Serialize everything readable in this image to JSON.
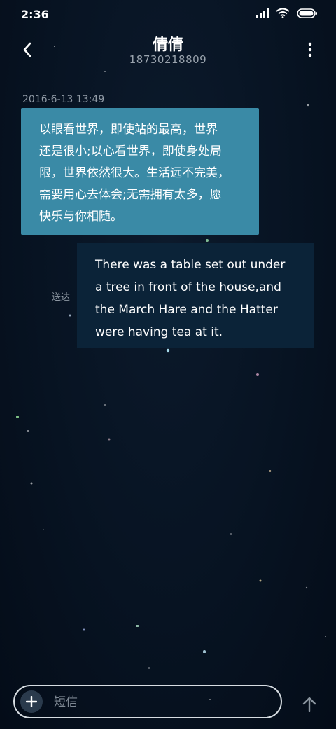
{
  "status_bar": {
    "time": "2:36",
    "icons": [
      "signal-icon",
      "wifi-icon",
      "battery-icon"
    ]
  },
  "header": {
    "contact_name": "倩倩",
    "contact_number": "18730218809",
    "back_icon": "chevron-left-icon",
    "menu_icon": "more-vertical-icon"
  },
  "conversation": {
    "timestamp": "2016-6-13 13:49",
    "messages": [
      {
        "direction": "incoming",
        "lines": [
          "以眼看世界，即使站的最高，世界",
          "还是很小;以心看世界，即使身处局",
          "限，世界依然很大。生活远不完美，",
          "需要用心去体会;无需拥有太多，愿",
          "快乐与你相随。"
        ]
      },
      {
        "direction": "outgoing",
        "lines": [
          "There was a table set out under",
          "a tree in front of the house,and",
          "the March Hare and the Hatter",
          "were having tea at it."
        ],
        "status": "送达"
      }
    ]
  },
  "composer": {
    "placeholder": "短信",
    "add_icon": "plus-icon",
    "send_icon": "arrow-up-icon"
  },
  "colors": {
    "incoming_bubble": "#3a8aa6",
    "outgoing_bubble": "#0b2338",
    "background": "#071322"
  }
}
